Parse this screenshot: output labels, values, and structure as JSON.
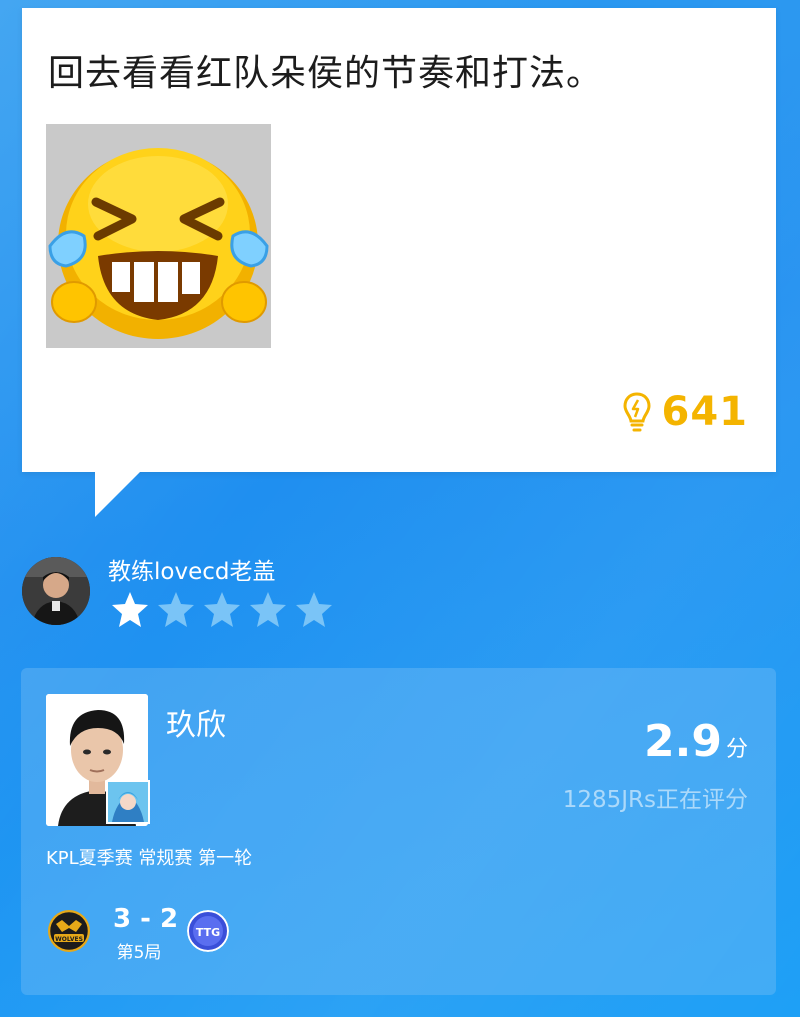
{
  "comment": {
    "text": "回去看看红队朵侯的节奏和打法。",
    "like_count": "641",
    "like_icon": "lightbulb-icon"
  },
  "coach": {
    "name": "教练lovecd老盖",
    "rating_stars": 1,
    "max_stars": 5
  },
  "player": {
    "name": "玖欣",
    "score_value": "2.9",
    "score_unit": "分",
    "raters_text": "1285JRs正在评分",
    "event": "KPL夏季赛 常规赛 第一轮"
  },
  "match": {
    "score": "3 - 2",
    "game": "第5局",
    "left_team_logo_text": "WOLVES",
    "right_team_logo_text": "TTG"
  },
  "colors": {
    "accent_yellow": "#f4b400",
    "bg_blue": "#1f8ff0"
  }
}
